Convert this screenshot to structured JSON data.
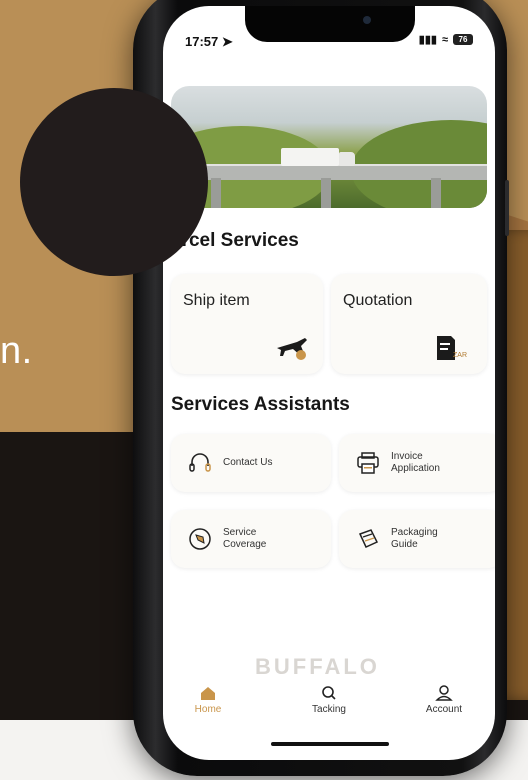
{
  "hero": {
    "partial_text": "n."
  },
  "status_bar": {
    "time": "17:57",
    "battery": "76"
  },
  "parcel_services": {
    "title": "arcel Services",
    "cards": [
      {
        "label": "Ship item",
        "icon": "airplane-icon"
      },
      {
        "label": "Quotation",
        "icon": "quote-doc-icon",
        "icon_text": "ZAR"
      }
    ]
  },
  "assistants": {
    "title": "Services Assistants",
    "items": [
      {
        "label": "Contact Us",
        "icon": "headset-icon"
      },
      {
        "label": "Invoice Application",
        "icon": "printer-icon"
      },
      {
        "label": "Service Coverage",
        "icon": "compass-icon"
      },
      {
        "label": "Packaging Guide",
        "icon": "package-icon"
      }
    ]
  },
  "watermark": "BUFFALO",
  "tabbar": {
    "tabs": [
      {
        "label": "Home",
        "icon": "home-icon",
        "active": true
      },
      {
        "label": "Tacking",
        "icon": "search-icon",
        "active": false
      },
      {
        "label": "Account",
        "icon": "user-icon",
        "active": false
      }
    ]
  },
  "colors": {
    "accent": "#b98f56",
    "dark": "#1a1512",
    "active_tab": "#c9954a"
  }
}
